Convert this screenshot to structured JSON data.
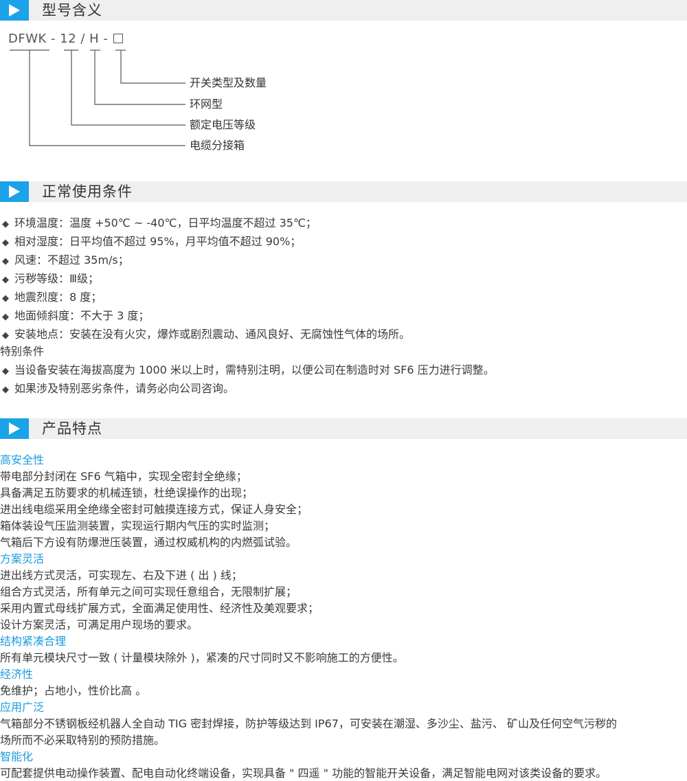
{
  "sections": {
    "model": {
      "title": "型号含义"
    },
    "conditions": {
      "title": "正常使用条件"
    },
    "features": {
      "title": "产品特点"
    }
  },
  "model_code": {
    "prefix": "DFWK - 12 / H - ",
    "labels": [
      "开关类型及数量",
      "环网型",
      "额定电压等级",
      "电缆分接箱"
    ]
  },
  "conditions": {
    "items": [
      "环境温度：温度 +50℃ ~ -40℃，日平均温度不超过 35℃；",
      "相对湿度：日平均值不超过 95%，月平均值不超过 90%；",
      "风速：不超过 35m/s；",
      "污秽等级：Ⅲ级；",
      "地震烈度：8 度；",
      "地面倾斜度：不大于 3 度；",
      "安装地点：安装在没有火灾，爆炸或剧烈震动、通风良好、无腐蚀性气体的场所。"
    ],
    "special_title": "特别条件",
    "special_items": [
      "当设备安装在海拔高度为 1000 米以上时，需特别注明，以便公司在制造时对 SF6 压力进行调整。",
      "如果涉及特别恶劣条件，请务必向公司咨询。"
    ],
    "bullet": "◆"
  },
  "features": {
    "groups": [
      {
        "title": "高安全性",
        "lines": [
          "带电部分封闭在 SF6 气箱中，实现全密封全绝缘；",
          "具备满足五防要求的机械连锁，杜绝误操作的出现；",
          "进出线电缆采用全绝缘全密封可触摸连接方式，保证人身安全；",
          "箱体装设气压监测装置，实现运行期内气压的实时监测；",
          "气箱后下方设有防爆泄压装置，通过权威机构的内燃弧试验。"
        ]
      },
      {
        "title": "方案灵活",
        "lines": [
          "进出线方式灵活，可实现左、右及下进 ( 出 ) 线；",
          "组合方式灵活，所有单元之间可实现任意组合，无限制扩展；",
          "采用内置式母线扩展方式，全面满足使用性、经济性及美观要求；",
          "设计方案灵活，可满足用户现场的要求。"
        ]
      },
      {
        "title": "结构紧凑合理",
        "lines": [
          "所有单元模块尺寸一致 ( 计量模块除外 )，紧凑的尺寸同时又不影响施工的方便性。"
        ]
      },
      {
        "title": "经济性",
        "lines": [
          "免维护；占地小，性价比高 。"
        ]
      },
      {
        "title": "应用广泛",
        "lines": [
          "气箱部分不锈钢板经机器人全自动 TIG 密封焊接，防护等级达到 IP67，可安装在潮湿、多沙尘、盐污、 矿山及任何空气污秽的",
          "场所而不必采取特别的预防措施。"
        ]
      },
      {
        "title": "智能化",
        "lines": [
          "可配套提供电动操作装置、配电自动化终端设备，实现具备 \" 四遥 \" 功能的智能开关设备，满足智能电网对该类设备的要求。"
        ]
      }
    ]
  },
  "colors": {
    "accent": "#1aa3e8",
    "header_bg": "#efefef",
    "heading_blue": "#1a9be0"
  }
}
